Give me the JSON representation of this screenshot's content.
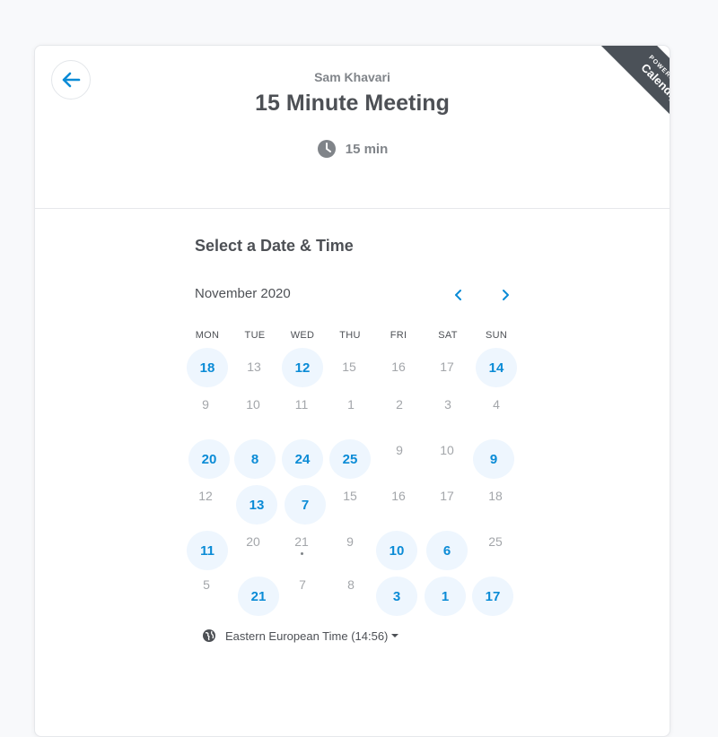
{
  "header": {
    "host_name": "Sam Khavari",
    "event_title": "15 Minute Meeting",
    "duration": "15 min",
    "ribbon_small": "POWERED BY",
    "ribbon_big": "Calendly"
  },
  "scheduler": {
    "section_title": "Select a Date & Time",
    "month_label": "November 2020",
    "weekdays": [
      "MON",
      "TUE",
      "WED",
      "THU",
      "FRI",
      "SAT",
      "SUN"
    ],
    "days": [
      {
        "label": "18",
        "available": true
      },
      {
        "label": "13",
        "available": false
      },
      {
        "label": "12",
        "available": true
      },
      {
        "label": "15",
        "available": false
      },
      {
        "label": "16",
        "available": false
      },
      {
        "label": "17",
        "available": false
      },
      {
        "label": "14",
        "available": true
      },
      {
        "label": "9",
        "available": false
      },
      {
        "label": "10",
        "available": false
      },
      {
        "label": "11",
        "available": false
      },
      {
        "label": "1",
        "available": false
      },
      {
        "label": "2",
        "available": false
      },
      {
        "label": "3",
        "available": false
      },
      {
        "label": "4",
        "available": false
      },
      {
        "label": "20",
        "available": true
      },
      {
        "label": "8",
        "available": true
      },
      {
        "label": "24",
        "available": true
      },
      {
        "label": "25",
        "available": true
      },
      {
        "label": "9",
        "available": false
      },
      {
        "label": "10",
        "available": false
      },
      {
        "label": "9",
        "available": true
      },
      {
        "label": "12",
        "available": false
      },
      {
        "label": "13",
        "available": true
      },
      {
        "label": "7",
        "available": true
      },
      {
        "label": "15",
        "available": false
      },
      {
        "label": "16",
        "available": false
      },
      {
        "label": "17",
        "available": false
      },
      {
        "label": "18",
        "available": false
      },
      {
        "label": "11",
        "available": true
      },
      {
        "label": "20",
        "available": false
      },
      {
        "label": "21",
        "available": false,
        "today": true
      },
      {
        "label": "9",
        "available": false
      },
      {
        "label": "10",
        "available": true
      },
      {
        "label": "6",
        "available": true
      },
      {
        "label": "25",
        "available": false
      },
      {
        "label": "5",
        "available": false
      },
      {
        "label": "21",
        "available": true
      },
      {
        "label": "7",
        "available": false
      },
      {
        "label": "8",
        "available": false
      },
      {
        "label": "3",
        "available": true
      },
      {
        "label": "1",
        "available": true
      },
      {
        "label": "17",
        "available": true
      }
    ],
    "timezone_label": "Eastern European Time (14:56)"
  },
  "colors": {
    "accent": "#0a8bd6",
    "available_bg": "#eef6fe",
    "ribbon_bg": "#4b5158",
    "muted_text": "#a3a6aa"
  },
  "icons": {
    "back": "arrow-left-icon",
    "duration": "clock-icon",
    "prev": "chevron-left-icon",
    "next": "chevron-right-icon",
    "timezone": "globe-icon",
    "dropdown": "caret-down-icon"
  }
}
